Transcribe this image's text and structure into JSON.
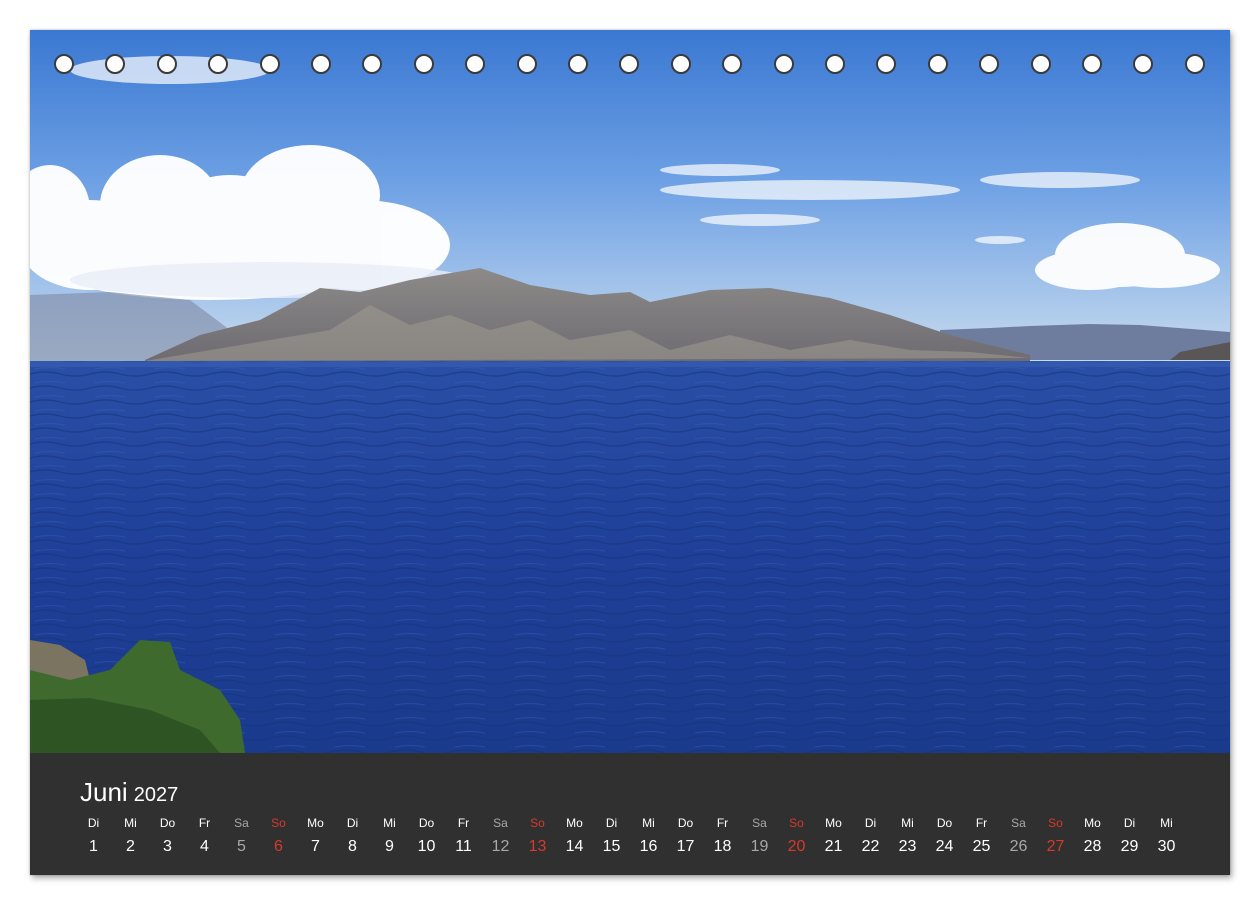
{
  "calendar": {
    "month": "Juni",
    "year": "2027",
    "days": [
      {
        "dow": "Di",
        "num": "1",
        "kind": "weekday"
      },
      {
        "dow": "Mi",
        "num": "2",
        "kind": "weekday"
      },
      {
        "dow": "Do",
        "num": "3",
        "kind": "weekday"
      },
      {
        "dow": "Fr",
        "num": "4",
        "kind": "weekday"
      },
      {
        "dow": "Sa",
        "num": "5",
        "kind": "sat"
      },
      {
        "dow": "So",
        "num": "6",
        "kind": "sun"
      },
      {
        "dow": "Mo",
        "num": "7",
        "kind": "weekday"
      },
      {
        "dow": "Di",
        "num": "8",
        "kind": "weekday"
      },
      {
        "dow": "Mi",
        "num": "9",
        "kind": "weekday"
      },
      {
        "dow": "Do",
        "num": "10",
        "kind": "weekday"
      },
      {
        "dow": "Fr",
        "num": "11",
        "kind": "weekday"
      },
      {
        "dow": "Sa",
        "num": "12",
        "kind": "sat"
      },
      {
        "dow": "So",
        "num": "13",
        "kind": "sun"
      },
      {
        "dow": "Mo",
        "num": "14",
        "kind": "weekday"
      },
      {
        "dow": "Di",
        "num": "15",
        "kind": "weekday"
      },
      {
        "dow": "Mi",
        "num": "16",
        "kind": "weekday"
      },
      {
        "dow": "Do",
        "num": "17",
        "kind": "weekday"
      },
      {
        "dow": "Fr",
        "num": "18",
        "kind": "weekday"
      },
      {
        "dow": "Sa",
        "num": "19",
        "kind": "sat"
      },
      {
        "dow": "So",
        "num": "20",
        "kind": "sun"
      },
      {
        "dow": "Mo",
        "num": "21",
        "kind": "weekday"
      },
      {
        "dow": "Di",
        "num": "22",
        "kind": "weekday"
      },
      {
        "dow": "Mi",
        "num": "23",
        "kind": "weekday"
      },
      {
        "dow": "Do",
        "num": "24",
        "kind": "weekday"
      },
      {
        "dow": "Fr",
        "num": "25",
        "kind": "weekday"
      },
      {
        "dow": "Sa",
        "num": "26",
        "kind": "sat"
      },
      {
        "dow": "So",
        "num": "27",
        "kind": "sun"
      },
      {
        "dow": "Mo",
        "num": "28",
        "kind": "weekday"
      },
      {
        "dow": "Di",
        "num": "29",
        "kind": "weekday"
      },
      {
        "dow": "Mi",
        "num": "30",
        "kind": "weekday"
      }
    ]
  },
  "colors": {
    "footer_bg": "#303030",
    "weekday_text": "#ffffff",
    "saturday_text": "#a8a8a8",
    "sunday_text": "#d63a2a",
    "sky_top": "#3f7fd6",
    "sea": "#1f3f98"
  },
  "icons": {
    "binding_hole": "binding-hole-icon"
  }
}
